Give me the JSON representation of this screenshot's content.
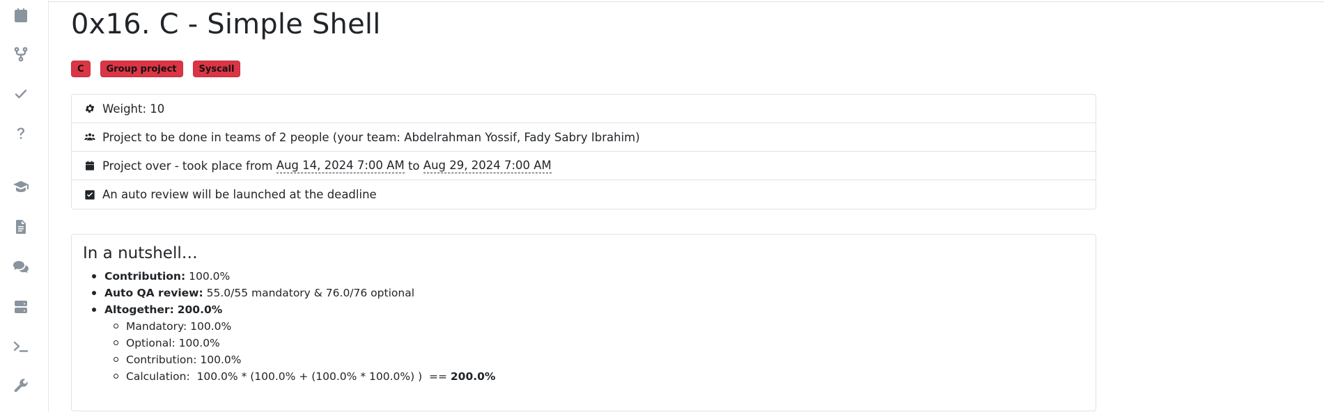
{
  "sidebar": {
    "icons": [
      "calendar-icon",
      "code-fork-icon",
      "check-icon",
      "question-icon",
      "graduation-cap-icon",
      "file-text-icon",
      "comments-icon",
      "server-icon",
      "terminal-icon",
      "wrench-icon"
    ]
  },
  "page": {
    "title": "0x16. C - Simple Shell",
    "tags": [
      "C",
      "Group project",
      "Syscall"
    ]
  },
  "info": {
    "weight": "Weight: 10",
    "team": "Project to be done in teams of 2 people (your team: Abdelrahman Yossif, Fady Sabry Ibrahim)",
    "period_prefix": "Project over - took place from",
    "start_date": "Aug 14, 2024 7:00 AM",
    "period_to": "to",
    "end_date": "Aug 29, 2024 7:00 AM",
    "auto_review": "An auto review will be launched at the deadline"
  },
  "nutshell": {
    "title": "In a nutshell…",
    "contribution_label": "Contribution:",
    "contribution_value": "100.0%",
    "qa_label": "Auto QA review:",
    "qa_value": "55.0/55 mandatory & 76.0/76 optional",
    "altogether_label": "Altogether:",
    "altogether_value": "200.0%",
    "mandatory": "Mandatory: 100.0%",
    "optional": "Optional: 100.0%",
    "contribution_sub": "Contribution: 100.0%",
    "calculation_prefix": "Calculation:  100.0% * (100.0% + (100.0% * 100.0%) )  ==",
    "calculation_result": "200.0%"
  },
  "colors": {
    "tag_bg": "#dc3545",
    "sidebar_icon": "#8a949e",
    "border": "#dee2e6"
  }
}
